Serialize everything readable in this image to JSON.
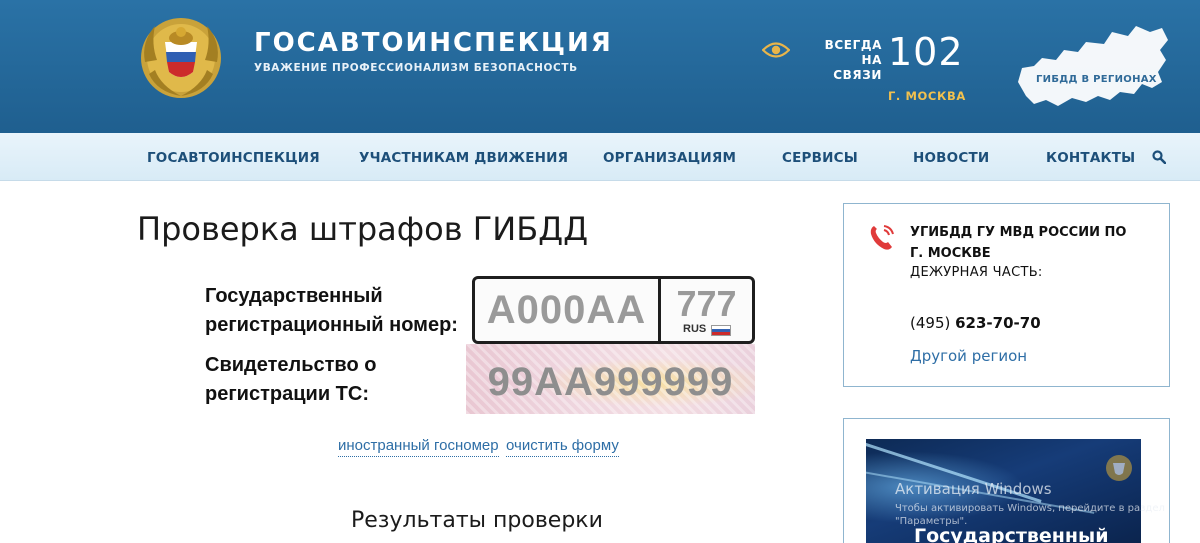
{
  "header": {
    "title": "ГОСАВТОИНСПЕКЦИЯ",
    "subtitle": "УВАЖЕНИЕ ПРОФЕССИОНАЛИЗМ БЕЗОПАСНОСТЬ",
    "always_line1": "ВСЕГДА",
    "always_line2": "НА СВЯЗИ",
    "hotline": "102",
    "city": "Г. МОСКВА",
    "map_label": "ГИБДД В РЕГИОНАХ"
  },
  "nav": {
    "items": [
      {
        "label": "ГОСАВТОИНСПЕКЦИЯ"
      },
      {
        "label": "УЧАСТНИКАМ ДВИЖЕНИЯ"
      },
      {
        "label": "ОРГАНИЗАЦИЯМ"
      },
      {
        "label": "СЕРВИСЫ"
      },
      {
        "label": "НОВОСТИ"
      },
      {
        "label": "КОНТАКТЫ"
      }
    ]
  },
  "main": {
    "page_title": "Проверка штрафов ГИБДД",
    "plate_label_1": "Государственный",
    "plate_label_2": "регистрационный номер:",
    "plate_number_placeholder": "А000АА",
    "plate_region_placeholder": "777",
    "plate_rus": "RUS",
    "cert_label_1": "Свидетельство о",
    "cert_label_2": "регистрации ТС:",
    "cert_placeholder": "99АА999999",
    "link_foreign": "иностранный госномер",
    "link_clear": "очистить форму",
    "results_title": "Результаты проверки"
  },
  "sidebar": {
    "dept_name": "УГИБДД ГУ МВД РОССИИ ПО Г. МОСКВЕ",
    "duty_label": "ДЕЖУРНАЯ ЧАСТЬ:",
    "phone_code": "(495)",
    "phone_number": "623-70-70",
    "other_region": "Другой регион",
    "banner_title": "Государственный доклад"
  },
  "watermark": {
    "title": "Активация Windows",
    "text": "Чтобы активировать Windows, перейдите в раздел \"Параметры\"."
  },
  "colors": {
    "header_bg": "#2a72a6",
    "nav_text": "#1d4f79",
    "accent_gold": "#f2c14e",
    "link": "#2e6ea6"
  }
}
